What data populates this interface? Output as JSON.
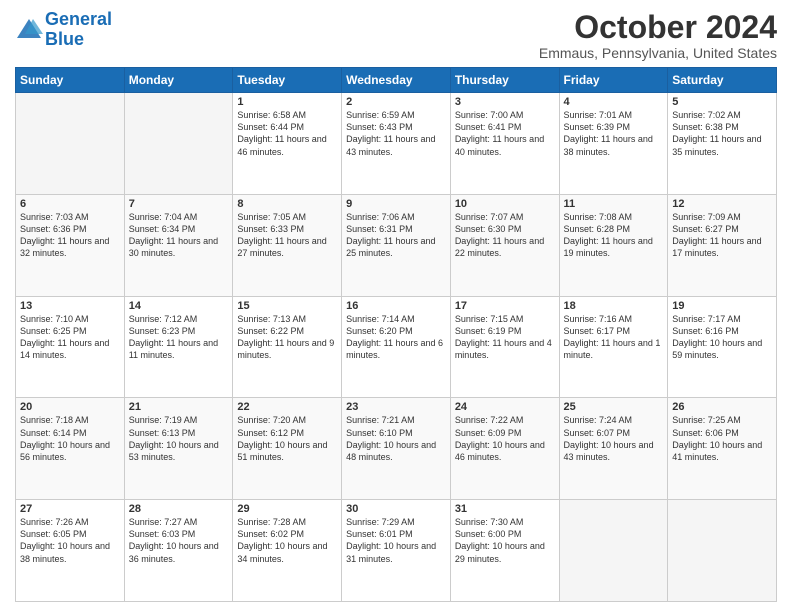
{
  "header": {
    "logo_line1": "General",
    "logo_line2": "Blue",
    "title": "October 2024",
    "location": "Emmaus, Pennsylvania, United States"
  },
  "weekdays": [
    "Sunday",
    "Monday",
    "Tuesday",
    "Wednesday",
    "Thursday",
    "Friday",
    "Saturday"
  ],
  "weeks": [
    [
      {
        "day": "",
        "info": ""
      },
      {
        "day": "",
        "info": ""
      },
      {
        "day": "1",
        "info": "Sunrise: 6:58 AM\nSunset: 6:44 PM\nDaylight: 11 hours and 46 minutes."
      },
      {
        "day": "2",
        "info": "Sunrise: 6:59 AM\nSunset: 6:43 PM\nDaylight: 11 hours and 43 minutes."
      },
      {
        "day": "3",
        "info": "Sunrise: 7:00 AM\nSunset: 6:41 PM\nDaylight: 11 hours and 40 minutes."
      },
      {
        "day": "4",
        "info": "Sunrise: 7:01 AM\nSunset: 6:39 PM\nDaylight: 11 hours and 38 minutes."
      },
      {
        "day": "5",
        "info": "Sunrise: 7:02 AM\nSunset: 6:38 PM\nDaylight: 11 hours and 35 minutes."
      }
    ],
    [
      {
        "day": "6",
        "info": "Sunrise: 7:03 AM\nSunset: 6:36 PM\nDaylight: 11 hours and 32 minutes."
      },
      {
        "day": "7",
        "info": "Sunrise: 7:04 AM\nSunset: 6:34 PM\nDaylight: 11 hours and 30 minutes."
      },
      {
        "day": "8",
        "info": "Sunrise: 7:05 AM\nSunset: 6:33 PM\nDaylight: 11 hours and 27 minutes."
      },
      {
        "day": "9",
        "info": "Sunrise: 7:06 AM\nSunset: 6:31 PM\nDaylight: 11 hours and 25 minutes."
      },
      {
        "day": "10",
        "info": "Sunrise: 7:07 AM\nSunset: 6:30 PM\nDaylight: 11 hours and 22 minutes."
      },
      {
        "day": "11",
        "info": "Sunrise: 7:08 AM\nSunset: 6:28 PM\nDaylight: 11 hours and 19 minutes."
      },
      {
        "day": "12",
        "info": "Sunrise: 7:09 AM\nSunset: 6:27 PM\nDaylight: 11 hours and 17 minutes."
      }
    ],
    [
      {
        "day": "13",
        "info": "Sunrise: 7:10 AM\nSunset: 6:25 PM\nDaylight: 11 hours and 14 minutes."
      },
      {
        "day": "14",
        "info": "Sunrise: 7:12 AM\nSunset: 6:23 PM\nDaylight: 11 hours and 11 minutes."
      },
      {
        "day": "15",
        "info": "Sunrise: 7:13 AM\nSunset: 6:22 PM\nDaylight: 11 hours and 9 minutes."
      },
      {
        "day": "16",
        "info": "Sunrise: 7:14 AM\nSunset: 6:20 PM\nDaylight: 11 hours and 6 minutes."
      },
      {
        "day": "17",
        "info": "Sunrise: 7:15 AM\nSunset: 6:19 PM\nDaylight: 11 hours and 4 minutes."
      },
      {
        "day": "18",
        "info": "Sunrise: 7:16 AM\nSunset: 6:17 PM\nDaylight: 11 hours and 1 minute."
      },
      {
        "day": "19",
        "info": "Sunrise: 7:17 AM\nSunset: 6:16 PM\nDaylight: 10 hours and 59 minutes."
      }
    ],
    [
      {
        "day": "20",
        "info": "Sunrise: 7:18 AM\nSunset: 6:14 PM\nDaylight: 10 hours and 56 minutes."
      },
      {
        "day": "21",
        "info": "Sunrise: 7:19 AM\nSunset: 6:13 PM\nDaylight: 10 hours and 53 minutes."
      },
      {
        "day": "22",
        "info": "Sunrise: 7:20 AM\nSunset: 6:12 PM\nDaylight: 10 hours and 51 minutes."
      },
      {
        "day": "23",
        "info": "Sunrise: 7:21 AM\nSunset: 6:10 PM\nDaylight: 10 hours and 48 minutes."
      },
      {
        "day": "24",
        "info": "Sunrise: 7:22 AM\nSunset: 6:09 PM\nDaylight: 10 hours and 46 minutes."
      },
      {
        "day": "25",
        "info": "Sunrise: 7:24 AM\nSunset: 6:07 PM\nDaylight: 10 hours and 43 minutes."
      },
      {
        "day": "26",
        "info": "Sunrise: 7:25 AM\nSunset: 6:06 PM\nDaylight: 10 hours and 41 minutes."
      }
    ],
    [
      {
        "day": "27",
        "info": "Sunrise: 7:26 AM\nSunset: 6:05 PM\nDaylight: 10 hours and 38 minutes."
      },
      {
        "day": "28",
        "info": "Sunrise: 7:27 AM\nSunset: 6:03 PM\nDaylight: 10 hours and 36 minutes."
      },
      {
        "day": "29",
        "info": "Sunrise: 7:28 AM\nSunset: 6:02 PM\nDaylight: 10 hours and 34 minutes."
      },
      {
        "day": "30",
        "info": "Sunrise: 7:29 AM\nSunset: 6:01 PM\nDaylight: 10 hours and 31 minutes."
      },
      {
        "day": "31",
        "info": "Sunrise: 7:30 AM\nSunset: 6:00 PM\nDaylight: 10 hours and 29 minutes."
      },
      {
        "day": "",
        "info": ""
      },
      {
        "day": "",
        "info": ""
      }
    ]
  ]
}
